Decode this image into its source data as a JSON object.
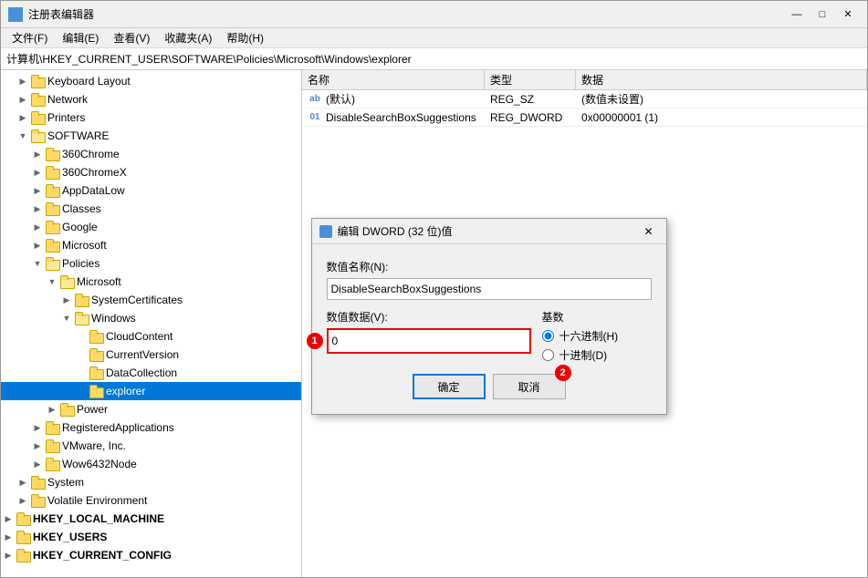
{
  "window": {
    "title": "注册表编辑器",
    "title_icon": "registry-editor-icon"
  },
  "menu": {
    "items": [
      "文件(F)",
      "编辑(E)",
      "查看(V)",
      "收藏夹(A)",
      "帮助(H)"
    ]
  },
  "address": {
    "label": "计算机\\HKEY_CURRENT_USER\\SOFTWARE\\Policies\\Microsoft\\Windows\\explorer"
  },
  "tree": {
    "items": [
      {
        "id": "keyboard-layout",
        "label": "Keyboard Layout",
        "indent": 1,
        "expanded": false,
        "has_children": true
      },
      {
        "id": "network",
        "label": "Network",
        "indent": 1,
        "expanded": false,
        "has_children": true
      },
      {
        "id": "printers",
        "label": "Printers",
        "indent": 1,
        "expanded": false,
        "has_children": true
      },
      {
        "id": "software",
        "label": "SOFTWARE",
        "indent": 1,
        "expanded": true,
        "has_children": true
      },
      {
        "id": "360chrome",
        "label": "360Chrome",
        "indent": 2,
        "expanded": false,
        "has_children": true
      },
      {
        "id": "360chromex",
        "label": "360ChromeX",
        "indent": 2,
        "expanded": false,
        "has_children": true
      },
      {
        "id": "appdatalow",
        "label": "AppDataLow",
        "indent": 2,
        "expanded": false,
        "has_children": true
      },
      {
        "id": "classes",
        "label": "Classes",
        "indent": 2,
        "expanded": false,
        "has_children": true
      },
      {
        "id": "google",
        "label": "Google",
        "indent": 2,
        "expanded": false,
        "has_children": true
      },
      {
        "id": "microsoft",
        "label": "Microsoft",
        "indent": 2,
        "expanded": false,
        "has_children": true
      },
      {
        "id": "policies",
        "label": "Policies",
        "indent": 2,
        "expanded": true,
        "has_children": true
      },
      {
        "id": "policies-microsoft",
        "label": "Microsoft",
        "indent": 3,
        "expanded": true,
        "has_children": true
      },
      {
        "id": "systemcertificates",
        "label": "SystemCertificates",
        "indent": 4,
        "expanded": false,
        "has_children": true
      },
      {
        "id": "windows",
        "label": "Windows",
        "indent": 4,
        "expanded": true,
        "has_children": true
      },
      {
        "id": "cloudcontent",
        "label": "CloudContent",
        "indent": 5,
        "expanded": false,
        "has_children": false
      },
      {
        "id": "currentversion",
        "label": "CurrentVersion",
        "indent": 5,
        "expanded": false,
        "has_children": false
      },
      {
        "id": "datacollection",
        "label": "DataCollection",
        "indent": 5,
        "expanded": false,
        "has_children": false
      },
      {
        "id": "explorer",
        "label": "explorer",
        "indent": 5,
        "expanded": false,
        "has_children": false,
        "selected": true
      },
      {
        "id": "power",
        "label": "Power",
        "indent": 3,
        "expanded": false,
        "has_children": true
      },
      {
        "id": "registeredapplications",
        "label": "RegisteredApplications",
        "indent": 2,
        "expanded": false,
        "has_children": true
      },
      {
        "id": "vmware",
        "label": "VMware, Inc.",
        "indent": 2,
        "expanded": false,
        "has_children": true
      },
      {
        "id": "wow6432node",
        "label": "Wow6432Node",
        "indent": 2,
        "expanded": false,
        "has_children": true
      },
      {
        "id": "system",
        "label": "System",
        "indent": 1,
        "expanded": false,
        "has_children": true
      },
      {
        "id": "volatile-environment",
        "label": "Volatile Environment",
        "indent": 1,
        "expanded": false,
        "has_children": true
      },
      {
        "id": "hkey-local-machine",
        "label": "HKEY_LOCAL_MACHINE",
        "indent": 0,
        "expanded": false,
        "has_children": true,
        "is_hive": true
      },
      {
        "id": "hkey-users",
        "label": "HKEY_USERS",
        "indent": 0,
        "expanded": false,
        "has_children": true,
        "is_hive": true
      },
      {
        "id": "hkey-current-config",
        "label": "HKEY_CURRENT_CONFIG",
        "indent": 0,
        "expanded": false,
        "has_children": true,
        "is_hive": true
      }
    ]
  },
  "table": {
    "headers": [
      "名称",
      "类型",
      "数据"
    ],
    "rows": [
      {
        "name": "(默认)",
        "type": "REG_SZ",
        "data": "(数值未设置)",
        "icon": "ab-icon"
      },
      {
        "name": "DisableSearchBoxSuggestions",
        "type": "REG_DWORD",
        "data": "0x00000001 (1)",
        "icon": "dword-icon"
      }
    ]
  },
  "dialog": {
    "title": "编辑 DWORD (32 位)值",
    "name_label": "数值名称(N):",
    "name_value": "DisableSearchBoxSuggestions",
    "value_label": "数值数据(V):",
    "value_input": "0",
    "base_title": "基数",
    "radios": [
      {
        "id": "hex",
        "label": "十六进制(H)",
        "checked": true
      },
      {
        "id": "dec",
        "label": "十进制(D)",
        "checked": false
      }
    ],
    "badge1": "1",
    "badge2": "2",
    "ok_button": "确定",
    "cancel_button": "取消"
  },
  "title_buttons": {
    "minimize": "—",
    "maximize": "□",
    "close": "✕"
  }
}
